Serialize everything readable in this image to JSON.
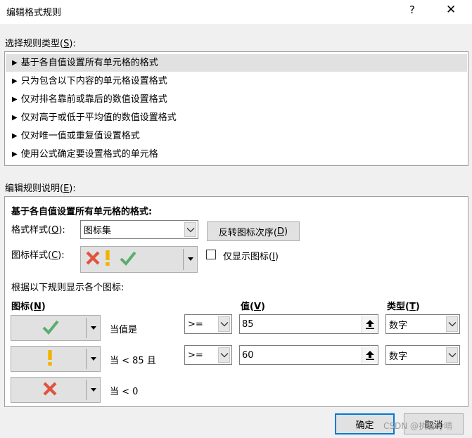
{
  "window": {
    "title": "编辑格式规则",
    "help_glyph": "?",
    "close_glyph": "✕"
  },
  "rule_type": {
    "label": "选择规则类型(",
    "accel": "S",
    "label_end": "):",
    "items": [
      {
        "label": "基于各自值设置所有单元格的格式",
        "selected": true
      },
      {
        "label": "只为包含以下内容的单元格设置格式",
        "selected": false
      },
      {
        "label": "仅对排名靠前或靠后的数值设置格式",
        "selected": false
      },
      {
        "label": "仅对高于或低于平均值的数值设置格式",
        "selected": false
      },
      {
        "label": "仅对唯一值或重复值设置格式",
        "selected": false
      },
      {
        "label": "使用公式确定要设置格式的单元格",
        "selected": false
      }
    ]
  },
  "description": {
    "label": "编辑规则说明(",
    "accel": "E",
    "label_end": "):",
    "heading": "基于各自值设置所有单元格的格式:",
    "format_style": {
      "label": "格式样式(",
      "accel": "O",
      "label_end": "):",
      "value": "图标集"
    },
    "reverse_button": {
      "label": "反转图标次序(",
      "accel": "D",
      "label_end": ")"
    },
    "icon_style": {
      "label": "图标样式(",
      "accel": "C",
      "label_end": "):",
      "icons": [
        "red-x",
        "yellow-exclamation",
        "green-check"
      ]
    },
    "show_icon_only": {
      "label": "仅显示图标(",
      "accel": "I",
      "label_end": ")",
      "checked": false
    },
    "rules_caption": "根据以下规则显示各个图标:",
    "columns": {
      "icon": {
        "label": "图标(",
        "accel": "N",
        "label_end": ")"
      },
      "value": {
        "label": "值(",
        "accel": "V",
        "label_end": ")"
      },
      "type": {
        "label": "类型(",
        "accel": "T",
        "label_end": ")"
      }
    },
    "rows": [
      {
        "icon": "green-check",
        "condition": "当值是",
        "operator": ">=",
        "value": "85",
        "type": "数字"
      },
      {
        "icon": "yellow-exclamation",
        "condition": "当 < 85 且",
        "operator": ">=",
        "value": "60",
        "type": "数字"
      },
      {
        "icon": "red-x",
        "condition": "当 < 0"
      }
    ]
  },
  "footer": {
    "ok_label": "确定",
    "cancel_label": "取消",
    "watermark": "CSDN @执着ry晴"
  },
  "colors": {
    "red": "#e0533e",
    "yellow": "#f0b400",
    "green": "#5aad6f",
    "accent": "#0078d7"
  }
}
